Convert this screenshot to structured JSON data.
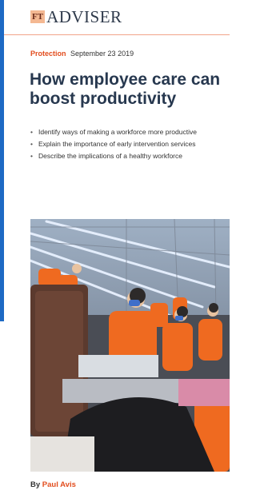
{
  "header": {
    "logo_ft": "FT",
    "logo_text": "ADVISER"
  },
  "article": {
    "section": "Protection",
    "date": "September 23 2019",
    "headline": "How employee care can boost productivity",
    "bullets": [
      "Identify ways of making a workforce more productive",
      "Explain the importance of early intervention services",
      "Describe the implications of a healthy workforce"
    ],
    "byline_prefix": "By",
    "author": "Paul Avis"
  },
  "colors": {
    "accent": "#e24d1e",
    "headline": "#27384f",
    "rail": "#1d6ac4"
  }
}
